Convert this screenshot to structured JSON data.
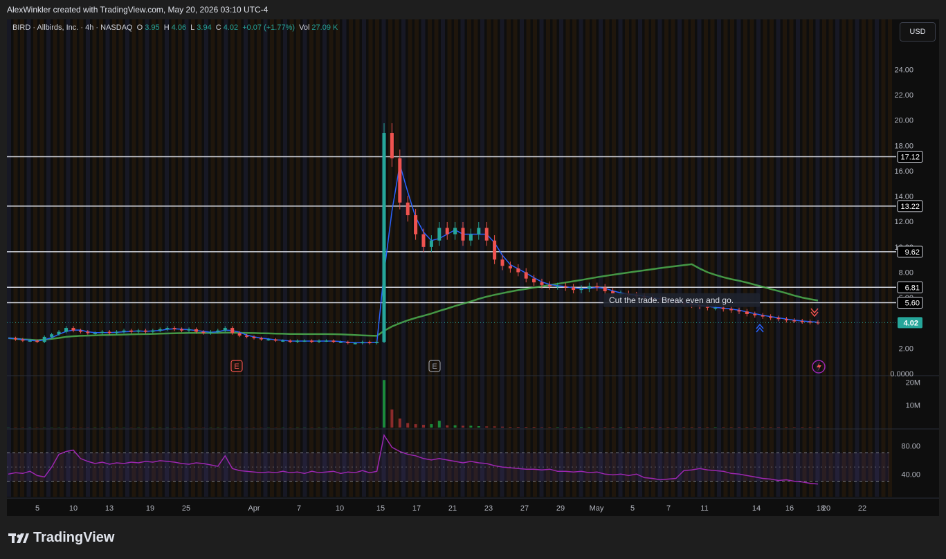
{
  "header": {
    "credit": "AlexWinkler created with TradingView.com, May 20, 2026 03:10 UTC-4"
  },
  "legend": {
    "symbol": "BIRD · Allbirds, Inc. · 4h · NASDAQ",
    "o_label": "O",
    "o": "3.95",
    "h_label": "H",
    "h": "4.06",
    "l_label": "L",
    "l": "3.94",
    "c_label": "C",
    "c": "4.02",
    "change": "+0.07 (+1.77%)",
    "vol_label": "Vol",
    "vol": "27.09 K"
  },
  "currency_button": "USD",
  "colors": {
    "up": "#26a69a",
    "down": "#ef5350",
    "hline": "#d1d4dc",
    "ma_blue": "#2962ff",
    "ma_green": "#4caf50",
    "rsi": "#9c27b0",
    "bg": "#0e0e0e"
  },
  "chart_data": {
    "type": "candlestick",
    "symbol": "BIRD",
    "interval": "4h",
    "y_ticks": [
      "24.00",
      "22.00",
      "20.00",
      "18.00",
      "16.00",
      "14.00",
      "12.00",
      "10.00",
      "8.00",
      "6.00",
      "2.00",
      "0.0000"
    ],
    "ylim": [
      0,
      25.5
    ],
    "x_ticks": [
      "5",
      "10",
      "13",
      "19",
      "25",
      "Apr",
      "7",
      "10",
      "15",
      "17",
      "21",
      "23",
      "27",
      "29",
      "May",
      "5",
      "7",
      "11",
      "14",
      "16",
      "18",
      "20",
      "22"
    ],
    "horizontal_levels": [
      "17.12",
      "13.22",
      "9.62",
      "6.81",
      "5.60"
    ],
    "last_price": "4.02",
    "annotation": "Cut the trade. Break even and go.",
    "earnings_markers": [
      "E",
      "E"
    ],
    "price_path": [
      2.8,
      2.7,
      2.6,
      2.6,
      2.5,
      2.9,
      3.1,
      3.3,
      3.6,
      3.4,
      3.3,
      3.2,
      3.2,
      3.3,
      3.2,
      3.3,
      3.4,
      3.3,
      3.4,
      3.3,
      3.4,
      3.5,
      3.6,
      3.5,
      3.4,
      3.5,
      3.3,
      3.2,
      3.3,
      3.4,
      3.6,
      3.2,
      3.0,
      2.9,
      2.8,
      2.7,
      2.7,
      2.6,
      2.6,
      2.5,
      2.6,
      2.6,
      2.5,
      2.6,
      2.6,
      2.5,
      2.5,
      2.4,
      2.4,
      2.5,
      2.4,
      2.5,
      19.0,
      17.0,
      13.5,
      12.5,
      11.0,
      10.0,
      10.5,
      11.5,
      11.0,
      11.5,
      10.5,
      11.0,
      11.5,
      10.5,
      9.0,
      8.5,
      8.3,
      8.0,
      7.5,
      7.2,
      7.0,
      6.9,
      6.9,
      6.8,
      6.6,
      6.7,
      6.9,
      6.8,
      6.5,
      6.3,
      6.3,
      6.2,
      6.1,
      6.0,
      5.9,
      5.8,
      5.7,
      5.6,
      5.5,
      5.4,
      5.3,
      5.2,
      5.2,
      5.1,
      5.0,
      4.9,
      4.7,
      4.6,
      4.5,
      4.4,
      4.3,
      4.2,
      4.15,
      4.1,
      4.05,
      4.02
    ],
    "volume_ticks": [
      "20M",
      "10M"
    ],
    "volume_series": [
      0.1,
      0.1,
      0.1,
      0.1,
      0.1,
      0.1,
      0.1,
      0.1,
      0.1,
      0.1,
      0.1,
      0.1,
      0.1,
      0.1,
      0.1,
      0.1,
      0.1,
      0.1,
      0.1,
      0.1,
      0.1,
      0.1,
      0.1,
      0.1,
      0.1,
      0.1,
      0.1,
      0.1,
      0.1,
      0.1,
      0.1,
      0.1,
      0.1,
      0.1,
      0.1,
      0.1,
      0.1,
      0.1,
      0.1,
      0.1,
      0.1,
      0.1,
      0.1,
      0.1,
      0.1,
      0.1,
      0.1,
      0.1,
      0.1,
      0.1,
      0.1,
      0.1,
      21.0,
      8.0,
      4.0,
      2.0,
      1.5,
      1.2,
      1.5,
      3.0,
      1.0,
      1.0,
      0.8,
      0.8,
      0.6,
      0.5,
      0.5,
      0.4,
      0.3,
      0.3,
      0.3,
      0.3,
      0.2,
      0.2,
      0.2,
      0.2,
      0.2,
      0.2,
      0.2,
      0.2,
      0.2,
      0.2,
      0.2,
      0.2,
      0.2,
      0.2,
      0.2,
      0.2,
      0.2,
      0.2,
      0.2,
      0.2,
      0.2,
      0.2,
      0.2,
      0.2,
      0.2,
      0.2,
      0.2,
      0.2,
      0.2,
      0.2,
      0.2,
      0.2,
      0.2,
      0.2,
      0.2,
      0.2
    ],
    "rsi_ticks": [
      "80.00",
      "40.00"
    ],
    "rsi_levels": [
      70,
      30
    ],
    "rsi_series": [
      40,
      42,
      41,
      44,
      38,
      36,
      50,
      68,
      72,
      74,
      62,
      58,
      55,
      57,
      54,
      56,
      55,
      57,
      56,
      58,
      57,
      59,
      58,
      57,
      55,
      54,
      56,
      55,
      53,
      51,
      66,
      48,
      45,
      44,
      43,
      42,
      43,
      42,
      44,
      42,
      43,
      41,
      44,
      42,
      43,
      44,
      41,
      43,
      42,
      45,
      42,
      44,
      95,
      78,
      72,
      68,
      66,
      62,
      60,
      62,
      60,
      58,
      56,
      58,
      56,
      55,
      52,
      50,
      49,
      48,
      47,
      47,
      46,
      47,
      44,
      44,
      43,
      44,
      42,
      43,
      40,
      39,
      40,
      38,
      40,
      35,
      34,
      32,
      33,
      34,
      45,
      46,
      48,
      46,
      45,
      44,
      41,
      40,
      38,
      36,
      34,
      33,
      31,
      32,
      30,
      29,
      27,
      26,
      26,
      30
    ]
  }
}
